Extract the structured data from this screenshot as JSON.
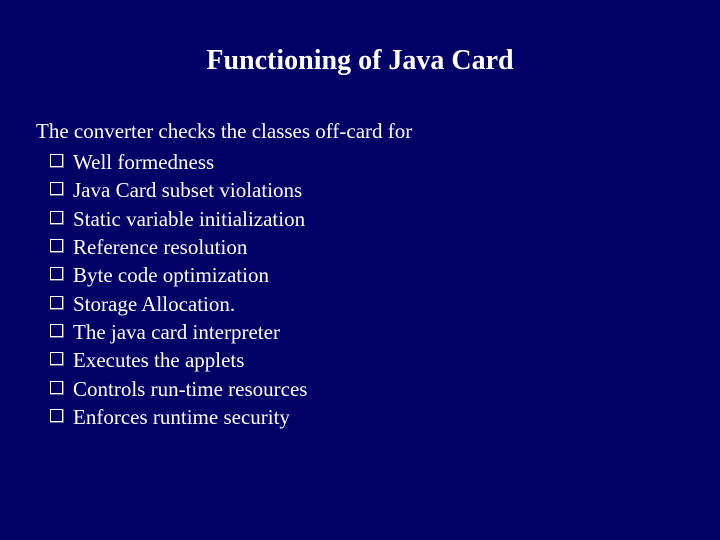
{
  "title": "Functioning of Java Card",
  "intro": "The converter checks the classes off-card for",
  "bullets": [
    "Well formedness",
    "Java Card subset violations",
    "Static variable initialization",
    "Reference resolution",
    "Byte code optimization",
    "Storage Allocation.",
    "The java card interpreter",
    "Executes the applets",
    "Controls run-time resources",
    "Enforces runtime security"
  ]
}
